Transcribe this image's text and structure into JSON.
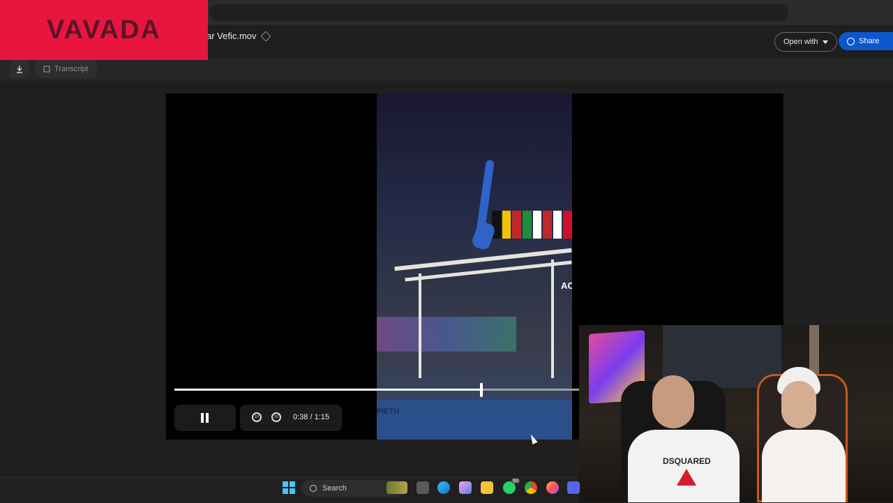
{
  "overlay": {
    "brand": "VAVADA"
  },
  "drive": {
    "file_name": "ar Vefic.mov",
    "open_with_label": "Open with",
    "share_label": "Share",
    "transcript_label": "Transcript"
  },
  "player": {
    "current_time": "0:38",
    "duration_sep": "/ 1:15",
    "progress": 0.758,
    "video_text": {
      "edge_letters": "AC",
      "banner": "PIETH"
    }
  },
  "webcam": {
    "tee_print": "DSQUARED"
  },
  "taskbar": {
    "search_label": "Search",
    "whatsapp_badge": "93",
    "apps": [
      "task-view-icon",
      "edge-icon",
      "copilot-icon",
      "file-explorer-icon",
      "whatsapp-icon",
      "chrome-icon",
      "firefox-icon",
      "discord-icon"
    ]
  },
  "colors": {
    "brand_bg": "#e8163f",
    "share_blue": "#0b57d0",
    "dark_bg": "#1f1f1f"
  }
}
